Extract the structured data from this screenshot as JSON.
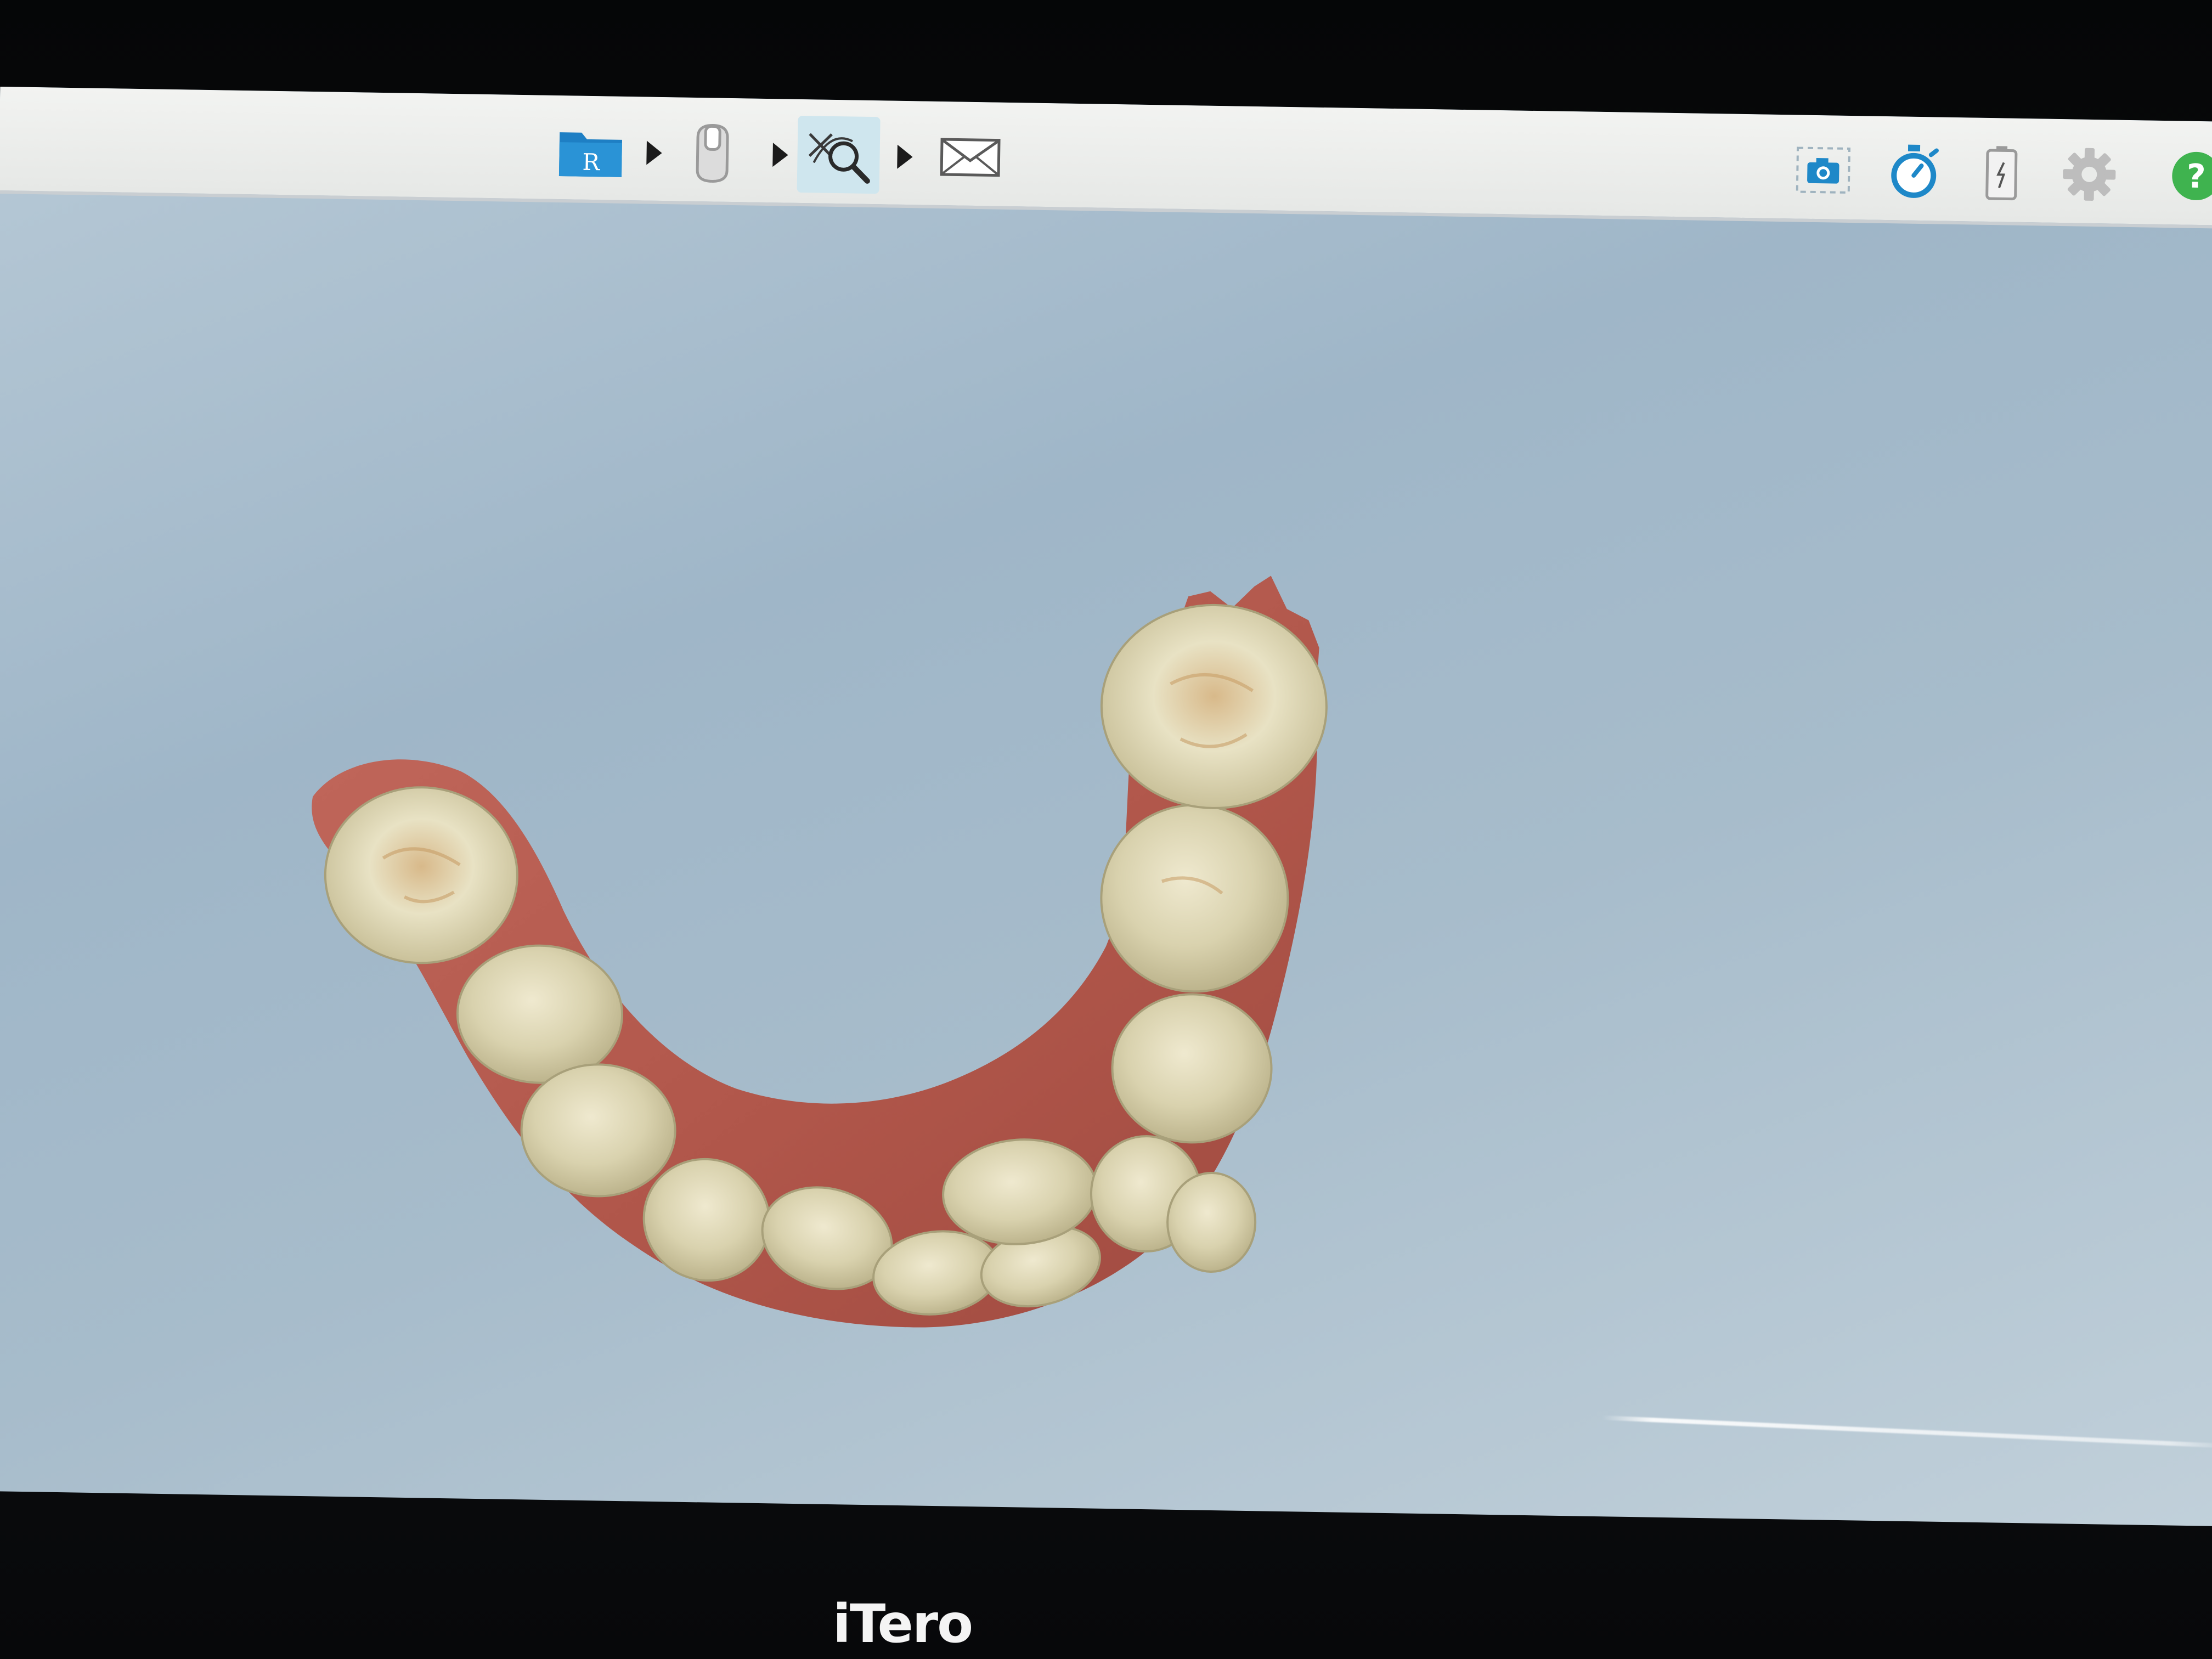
{
  "toolbar": {
    "workflow": [
      {
        "name": "rx-folder-icon",
        "label": "R",
        "active": false
      },
      {
        "name": "scan-icon",
        "active": false
      },
      {
        "name": "view-tools-icon",
        "active": true
      },
      {
        "name": "send-mail-icon",
        "active": false
      }
    ],
    "utilities": [
      {
        "name": "camera-icon"
      },
      {
        "name": "stopwatch-icon"
      },
      {
        "name": "battery-icon"
      },
      {
        "name": "settings-gear-icon"
      },
      {
        "name": "help-icon",
        "label": "?"
      }
    ]
  },
  "viewport": {
    "content": "dental-arch-scan-3d-model"
  },
  "bezel": {
    "brand": "iTero"
  },
  "colors": {
    "toolbar_bg": "#eceeec",
    "viewport_bg": "#a9bfcf",
    "accent_blue": "#1e88c8",
    "help_green": "#3fb34f",
    "gum": "#b8574c",
    "tooth": "#ddd8b8"
  }
}
